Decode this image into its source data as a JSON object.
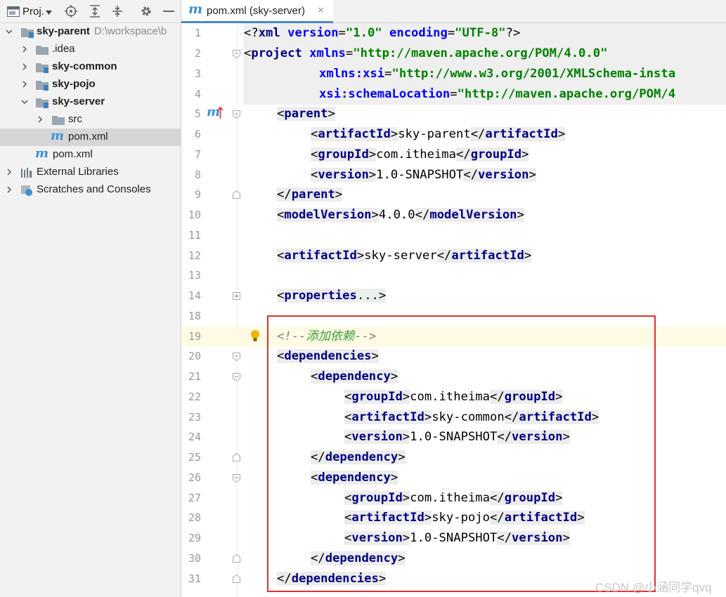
{
  "project_panel": {
    "title": "Proj.",
    "tree": [
      {
        "label": "sky-parent",
        "path": "D:\\workspace\\b",
        "icon": "module-folder-icon",
        "expanded": true
      },
      {
        "label": ".idea",
        "icon": "folder-icon",
        "expanded": false
      },
      {
        "label": "sky-common",
        "icon": "module-folder-icon",
        "expanded": false
      },
      {
        "label": "sky-pojo",
        "icon": "module-folder-icon",
        "expanded": false
      },
      {
        "label": "sky-server",
        "icon": "module-folder-icon",
        "expanded": true
      },
      {
        "label": "src",
        "icon": "folder-icon",
        "expanded": false
      },
      {
        "label": "pom.xml",
        "icon": "maven-file-icon",
        "selected": true
      },
      {
        "label": "pom.xml",
        "icon": "maven-file-icon"
      },
      {
        "label": "External Libraries",
        "icon": "library-icon",
        "expanded": false
      },
      {
        "label": "Scratches and Consoles",
        "icon": "scratches-icon",
        "expanded": false
      }
    ]
  },
  "editor_tab": {
    "label": "pom.xml (sky-server)",
    "icon": "maven-file-icon",
    "close": "×"
  },
  "code": {
    "line_numbers": [
      "1",
      "2",
      "3",
      "4",
      "5",
      "6",
      "7",
      "8",
      "9",
      "10",
      "11",
      "12",
      "13",
      "14",
      "18",
      "19",
      "20",
      "21",
      "22",
      "23",
      "24",
      "25",
      "26",
      "27",
      "28",
      "29",
      "30",
      "31"
    ],
    "xml_decl": {
      "open": "<?",
      "name": "xml",
      "attr1": "version",
      "val1": "\"1.0\"",
      "attr2": "encoding",
      "val2": "\"UTF-8\"",
      "close": "?>"
    },
    "project": {
      "tag": "project",
      "attr1": "xmlns",
      "val1": "\"http://maven.apache.org/POM/4.0.0\"",
      "attr2": "xmlns:xsi",
      "val2": "\"http://www.w3.org/2001/XMLSchema-insta",
      "attr3": "xsi:schemaLocation",
      "val3": "\"http://maven.apache.org/POM/4"
    },
    "parent": {
      "tag": "parent",
      "artifactId": "sky-parent",
      "groupId": "com.itheima",
      "version": "1.0-SNAPSHOT"
    },
    "modelVersion": {
      "tag": "modelVersion",
      "value": "4.0.0"
    },
    "artifactId": {
      "tag": "artifactId",
      "value": "sky-server"
    },
    "properties": {
      "tag": "properties",
      "folded": "..."
    },
    "comment": {
      "open": "<!--",
      "text": "添加依赖",
      "close": "-->"
    },
    "tags": {
      "dependencies": "dependencies",
      "dependency": "dependency",
      "groupId": "groupId",
      "artifactId": "artifactId",
      "version": "version"
    },
    "dependencies": [
      {
        "groupId": "com.itheima",
        "artifactId": "sky-common",
        "version": "1.0-SNAPSHOT"
      },
      {
        "groupId": "com.itheima",
        "artifactId": "sky-pojo",
        "version": "1.0-SNAPSHOT"
      }
    ]
  },
  "watermark": "CSDN @小涵同学qvq",
  "colors": {
    "tag": "#000080",
    "attr": "#0000ff",
    "value": "#008000",
    "highlight_box": "#e03030",
    "current_line": "#fffae3"
  }
}
